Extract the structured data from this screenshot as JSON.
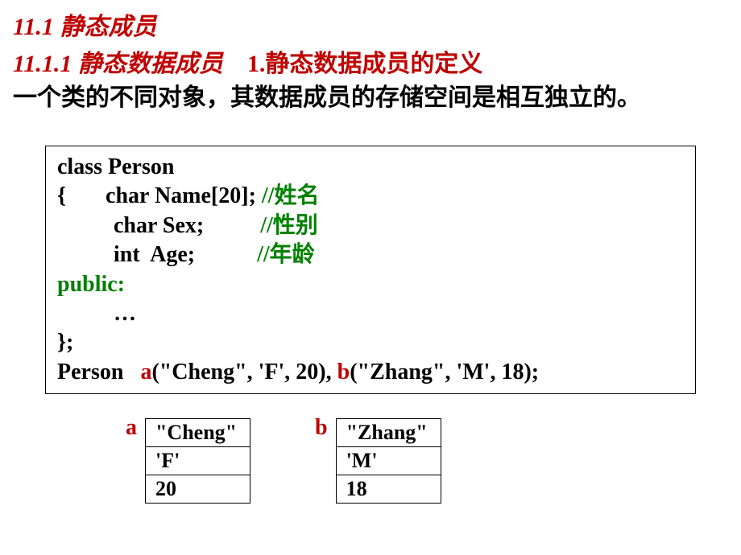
{
  "headings": {
    "h1": "11.1 静态成员",
    "h2": "11.1.1  静态数据成员",
    "h3": "1.静态数据成员的定义"
  },
  "paragraph": "一个类的不同对象，其数据成员的存储空间是相互独立的。",
  "code": {
    "line1": "class Person",
    "line2a": "{       char Name[20]; ",
    "line2b": "//姓名",
    "line3a": "          char Sex;          ",
    "line3b": "//性别",
    "line4a": "          int  Age;           ",
    "line4b": "//年龄",
    "line5": "public:",
    "line6": "          …",
    "line7": "};",
    "line8a": "Person   ",
    "line8b": "a",
    "line8c": "(\"Cheng\", 'F', 20), ",
    "line8d": "b",
    "line8e": "(\"Zhang\", 'M', 18);"
  },
  "objects": {
    "a": {
      "label": "a",
      "name": "\"Cheng\"",
      "sex": "'F'",
      "age": "20"
    },
    "b": {
      "label": "b",
      "name": "\"Zhang\"",
      "sex": "'M'",
      "age": "18"
    }
  }
}
